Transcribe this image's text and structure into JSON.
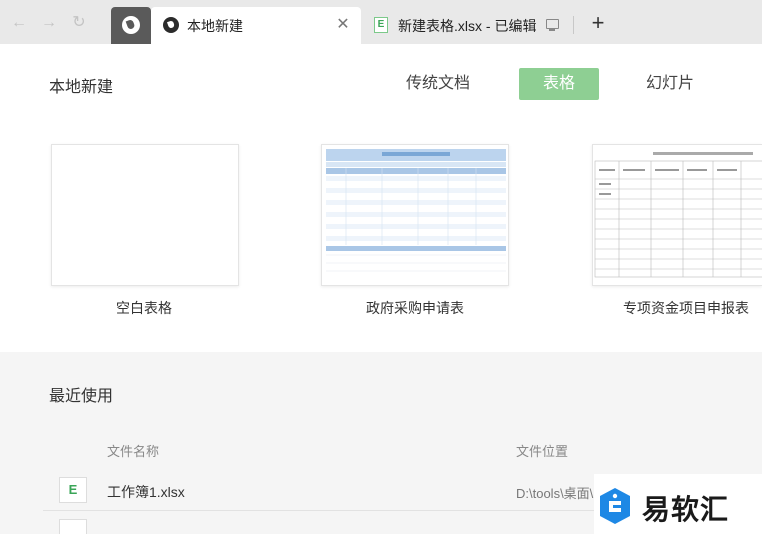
{
  "tabs": [
    {
      "label": "本地新建",
      "active": true
    },
    {
      "label": "新建表格.xlsx - 已编辑",
      "icon": "xlsx-file-icon"
    }
  ],
  "header": {
    "title": "本地新建",
    "type_tabs": [
      "传统文档",
      "表格",
      "幻灯片"
    ],
    "selected_type": "表格"
  },
  "templates": [
    {
      "name": "空白表格",
      "thumb": "blank"
    },
    {
      "name": "政府采购申请表",
      "thumb": "procurement-form"
    },
    {
      "name": "专项资金项目申报表",
      "thumb": "fund-application-form"
    }
  ],
  "recent": {
    "title": "最近使用",
    "columns": [
      "文件名称",
      "文件位置"
    ],
    "files": [
      {
        "name": "工作簿1.xlsx",
        "location": "D:\\tools\\桌面\\",
        "icon_letter": "E"
      }
    ]
  },
  "watermark": {
    "text": "易软汇"
  },
  "colors": {
    "accent_green": "#8ecf93",
    "table_blue": "#7aa7d6",
    "tab_bar": "#e9e9e9"
  },
  "icons": {
    "back": "arrow-left-icon",
    "forward": "arrow-right-icon",
    "reload": "reload-icon",
    "close": "close-icon",
    "new_tab": "plus-icon",
    "screen": "monitor-icon"
  }
}
